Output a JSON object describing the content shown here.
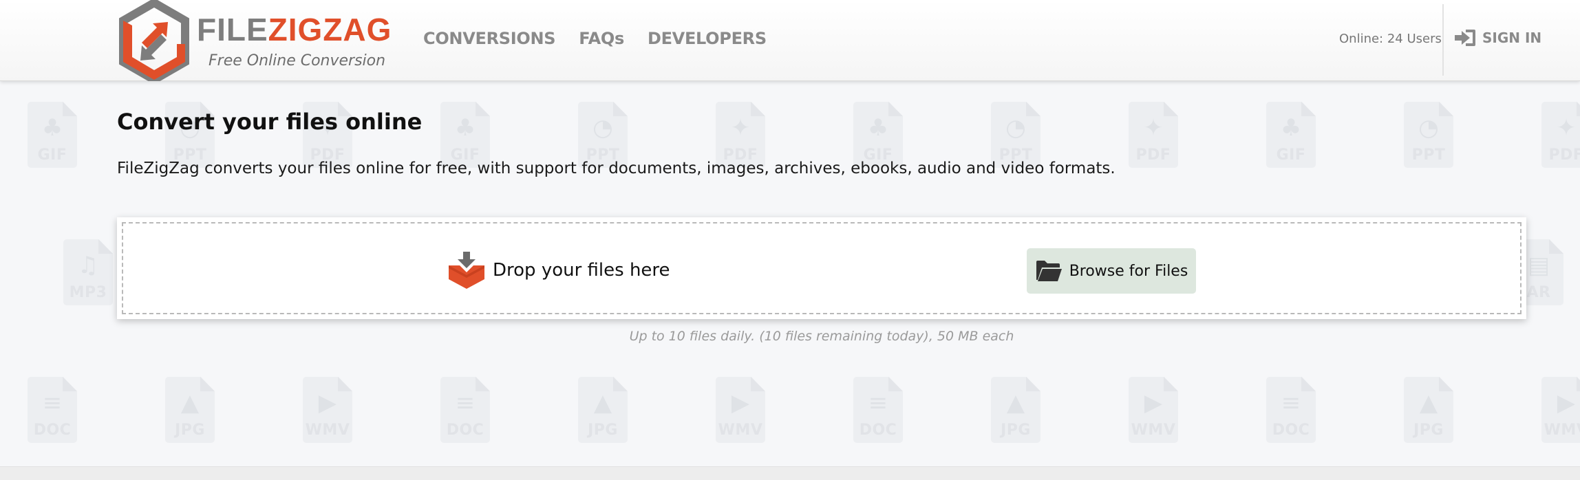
{
  "brand": {
    "word_file": "FILE",
    "word_zigzag": "ZIGZAG",
    "tagline": "Free Online Conversion",
    "colors": {
      "grey": "#7d7d7d",
      "accent": "#e04f2a"
    }
  },
  "nav": {
    "items": [
      {
        "label": "CONVERSIONS"
      },
      {
        "label": "FAQs"
      },
      {
        "label": "DEVELOPERS"
      }
    ]
  },
  "header": {
    "online_text": "Online: 24 Users",
    "signin_label": "SIGN IN",
    "signin_icon": "sign-in-icon"
  },
  "main": {
    "title": "Convert your files online",
    "intro": "FileZigZag converts your files online for free, with support for documents, images, archives, ebooks, audio and video formats.",
    "dropzone": {
      "drop_label": "Drop your files here",
      "drop_icon": "drop-box-icon",
      "browse_label": "Browse for Files",
      "browse_icon": "folder-icon"
    },
    "limit_text": "Up to 10 files daily. (10 files remaining today), 50 MB each"
  },
  "background_pattern": {
    "row1": [
      "GIF",
      "PPT",
      "PDF",
      "GIF",
      "PPT",
      "PDF",
      "GIF",
      "PPT",
      "PDF",
      "GIF",
      "PPT",
      "PDF"
    ],
    "row2_edges": [
      "MP3",
      "AR"
    ],
    "row3": [
      "DOC",
      "JPG",
      "WMV",
      "DOC",
      "JPG",
      "WMV",
      "DOC",
      "JPG",
      "WMV",
      "DOC",
      "JPG",
      "WMV"
    ]
  }
}
